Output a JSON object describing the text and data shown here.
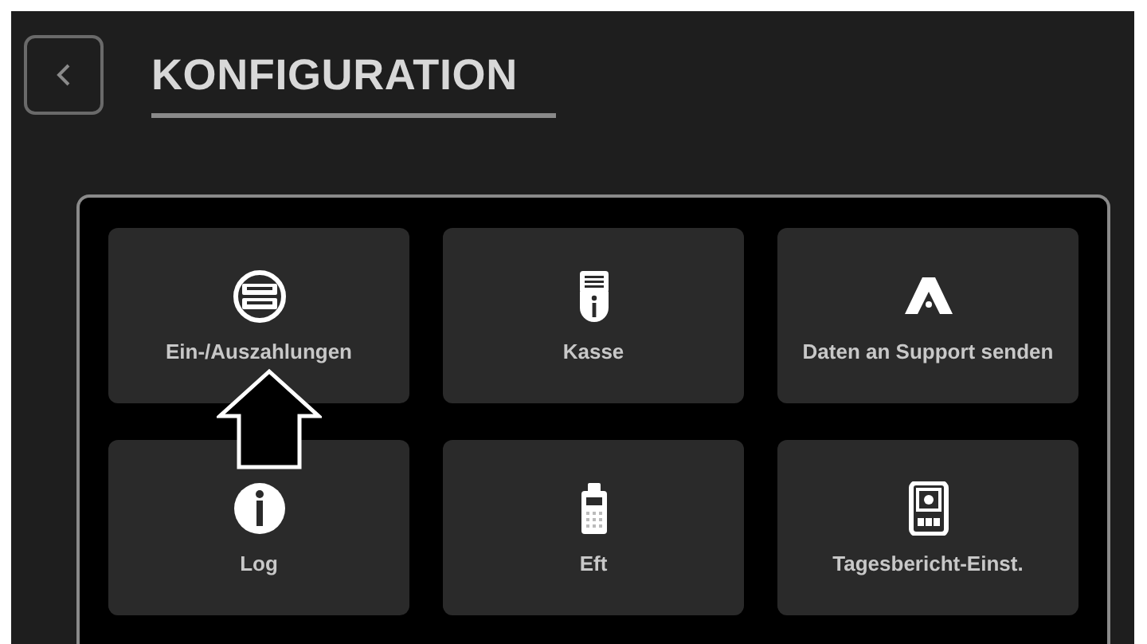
{
  "header": {
    "title": "KONFIGURATION"
  },
  "tiles": [
    {
      "label": "Ein-/Auszahlungen",
      "kind": "cash"
    },
    {
      "label": "Kasse",
      "kind": "register"
    },
    {
      "label": "Daten an Support senden",
      "kind": "support"
    },
    {
      "label": "Log",
      "kind": "info"
    },
    {
      "label": "Eft",
      "kind": "terminal"
    },
    {
      "label": "Tagesbericht-Einst.",
      "kind": "report"
    }
  ],
  "annotation": {
    "kind": "arrow"
  }
}
